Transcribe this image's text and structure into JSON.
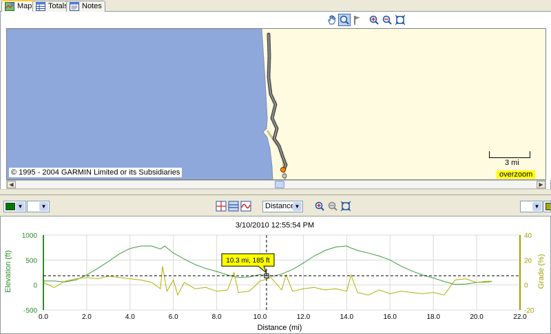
{
  "tabs": [
    {
      "label": "Map",
      "icon": "map-icon",
      "active": true
    },
    {
      "label": "Totals",
      "icon": "table-icon",
      "active": false
    },
    {
      "label": "Notes",
      "icon": "notes-icon",
      "active": false
    }
  ],
  "map": {
    "toolbar": [
      "hand-pan-icon",
      "magnifier-icon",
      "flag-icon",
      "zoom-in-icon",
      "zoom-out-icon",
      "zoom-extent-icon"
    ],
    "copyright": "© 1995 - 2004 GARMIN Limited or its Subsidiaries",
    "scale_label": "3 mi",
    "overzoom_label": "overzoom",
    "colors": {
      "water": "#8fa8dc",
      "land": "#fffbe0",
      "track": "#555555"
    }
  },
  "profile_toolbar": {
    "left_color": "#007a00",
    "right_color": "#a8a800",
    "x_axis_select": "Distance",
    "tools": [
      "elevation-chart-icon",
      "grade-chart-icon",
      "speed-chart-icon",
      "zoom-in-icon",
      "zoom-out-icon",
      "zoom-extent-icon"
    ]
  },
  "chart_data": {
    "type": "line",
    "title": "3/10/2010 12:55:54 PM",
    "xlabel": "Distance (mi)",
    "ylabel": "Elevation (ft)",
    "y2label": "Grade (%)",
    "xlim": [
      0,
      22
    ],
    "ylim": [
      -500,
      1000
    ],
    "y2lim": [
      -20,
      40
    ],
    "x_ticks": [
      "0.0",
      "2.0",
      "4.0",
      "6.0",
      "8.0",
      "10.0",
      "12.0",
      "14.0",
      "16.0",
      "18.0",
      "20.0",
      "22.0"
    ],
    "y_ticks": [
      "-500",
      "0",
      "500",
      "1000"
    ],
    "y2_ticks": [
      "-20",
      "0",
      "20",
      "40"
    ],
    "cursor": {
      "x": 10.3,
      "y": 185,
      "label": "10.3 mi, 185 ft"
    },
    "grid": true,
    "series": [
      {
        "color": "#3c9a3c",
        "axis": "left",
        "x": [
          0,
          0.5,
          1.0,
          1.5,
          2.0,
          2.5,
          3.0,
          3.5,
          4.0,
          4.5,
          5.0,
          5.4,
          5.6,
          5.8,
          6.0,
          6.5,
          7.0,
          7.5,
          8.0,
          8.5,
          9.0,
          9.5,
          10.0,
          10.3,
          10.6,
          11.0,
          11.5,
          12.0,
          12.5,
          13.0,
          13.5,
          14.0,
          14.2,
          14.5,
          15.0,
          15.5,
          16.0,
          16.5,
          17.0,
          17.5,
          18.0,
          18.5,
          19.0,
          19.5,
          20.0,
          20.5,
          20.7
        ],
        "values": [
          80,
          80,
          60,
          100,
          200,
          330,
          470,
          620,
          730,
          780,
          780,
          720,
          780,
          710,
          640,
          520,
          410,
          330,
          270,
          200,
          150,
          160,
          210,
          185,
          175,
          220,
          310,
          440,
          580,
          690,
          760,
          780,
          740,
          690,
          640,
          580,
          500,
          380,
          280,
          200,
          140,
          70,
          10,
          20,
          50,
          60,
          70
        ]
      },
      {
        "color": "#b0b000",
        "axis": "right",
        "x": [
          0,
          0.5,
          1.0,
          1.5,
          2.0,
          2.5,
          3.0,
          3.5,
          4.0,
          4.5,
          5.0,
          5.4,
          5.5,
          5.7,
          6.0,
          6.2,
          6.5,
          7.0,
          7.5,
          8.0,
          8.5,
          8.8,
          9.0,
          9.5,
          10.0,
          10.5,
          11.0,
          11.2,
          11.5,
          12.0,
          12.5,
          13.0,
          13.5,
          14.0,
          14.2,
          14.5,
          15.0,
          15.5,
          16.0,
          16.5,
          17.0,
          17.5,
          18.0,
          18.5,
          19.0,
          19.5,
          20.0,
          20.5,
          20.7
        ],
        "values": [
          2,
          -2,
          3,
          5,
          6,
          5,
          7,
          6,
          5,
          4,
          2,
          -3,
          15,
          -5,
          4,
          -8,
          2,
          -3,
          -2,
          -5,
          -4,
          10,
          -6,
          -5,
          3,
          6,
          -4,
          8,
          -5,
          -3,
          -2,
          -4,
          -3,
          -5,
          8,
          -6,
          -8,
          -4,
          -7,
          -5,
          -6,
          -7,
          -6,
          -8,
          4,
          5,
          2,
          3,
          3
        ]
      }
    ]
  }
}
